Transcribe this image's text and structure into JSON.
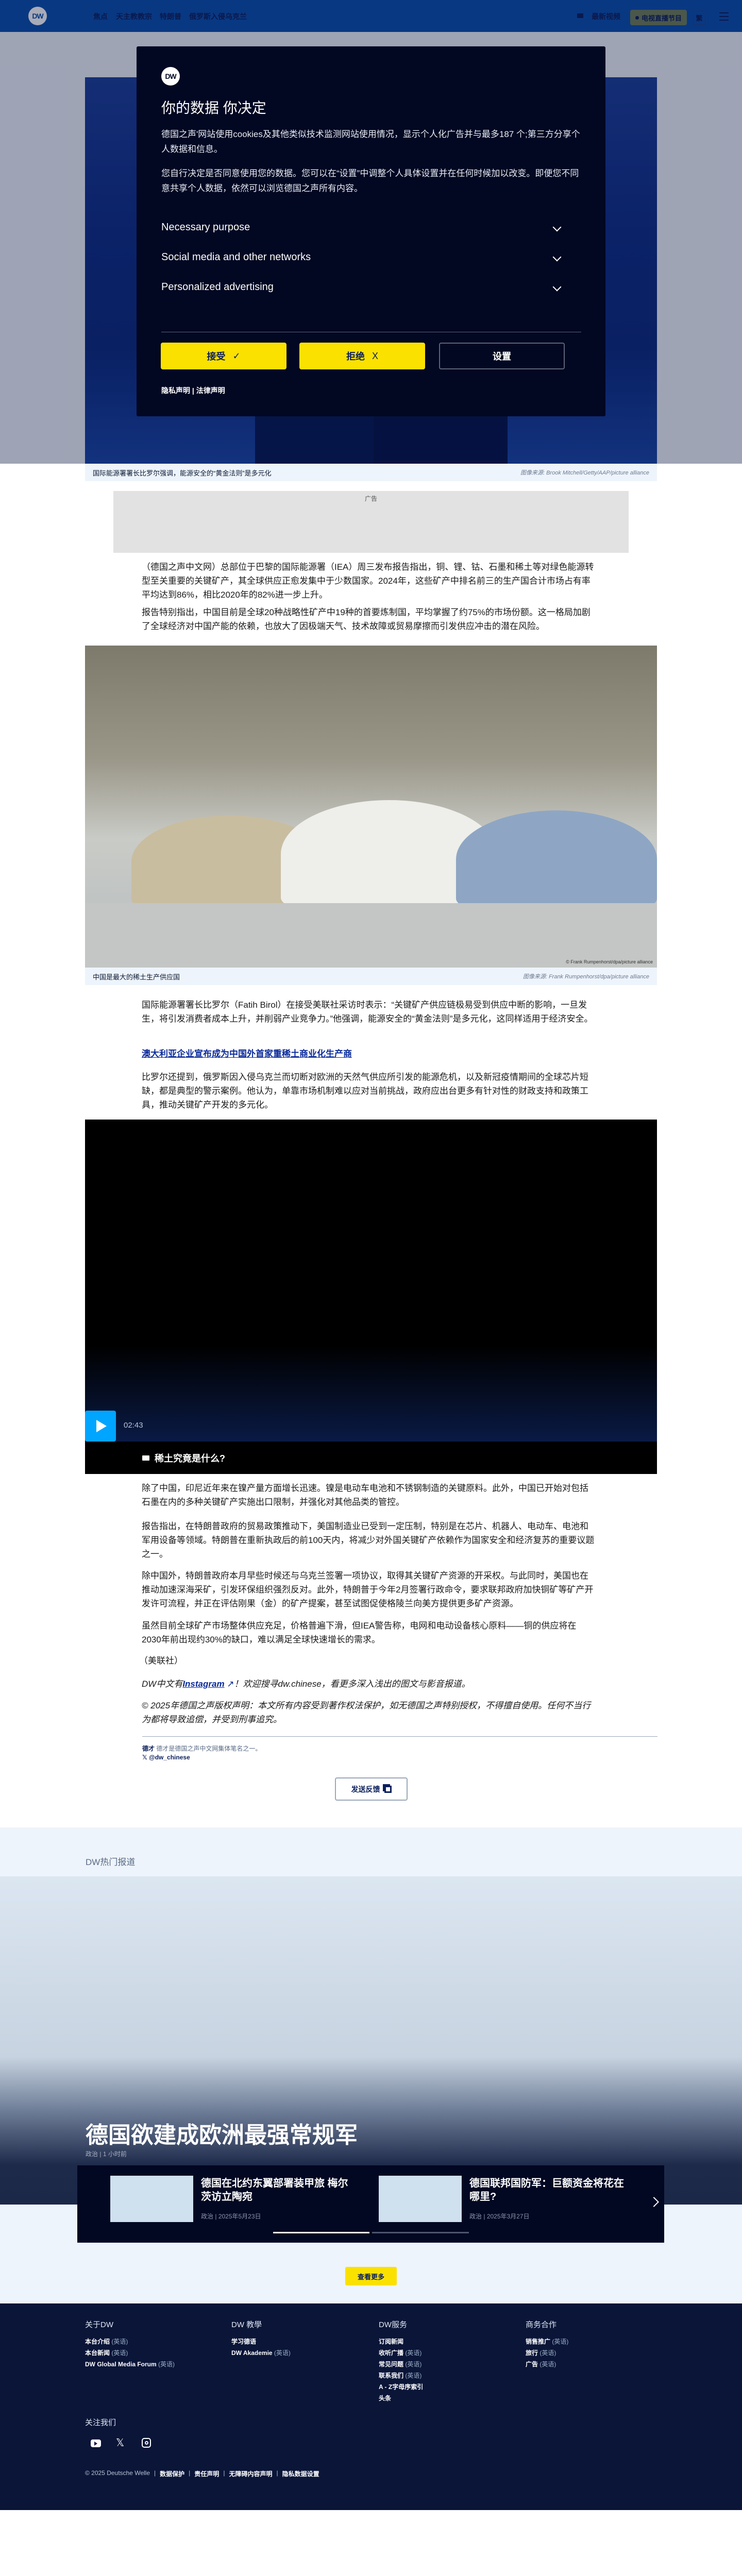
{
  "header": {
    "logo": "DW",
    "nav": [
      "焦点",
      "天主教教宗",
      "特朗普",
      "俄罗斯入侵乌克兰"
    ],
    "latest_videos": "最新视频",
    "live_tv": "电视直播节目",
    "lang_toggle": "繁"
  },
  "cookie_modal": {
    "logo": "DW",
    "title": "你的数据 你决定",
    "text1": "德国之声'网站使用cookies及其他类似技术监测网站使用情况，显示个人化广告并与最多187 个;第三方分享个人数据和信息。",
    "text2": "您自行决定是否同意使用您的数据。您可以在“设置”中调整个人具体设置并在任何时候加以改变。即便您不同意共享个人数据，依然可以浏览德国之声所有内容。",
    "sections": [
      "Necessary purpose",
      "Social media and other networks",
      "Personalized advertising"
    ],
    "accept": "接受",
    "reject": "拒绝",
    "settings": "设置",
    "privacy": "隐私声明",
    "legal": "法律声明"
  },
  "hero_caption": {
    "text": "国际能源署署长比罗尔强调，能源安全的“黄金法则”是多元化",
    "credit": "图像来源: Brook Mitchell/Getty/AAP/picture alliance"
  },
  "ad_label": "广告",
  "article": {
    "p1": "（德国之声中文网）总部位于巴黎的国际能源署（IEA）周三发布报告指出，铜、锂、钴、石墨和稀土等对绿色能源转型至关重要的关键矿产，其全球供应正愈发集中于少数国家。2024年，这些矿产中排名前三的生产国合计市场占有率平均达到86%，相比2020年的82%进一步上升。",
    "p2": "报告特别指出，中国目前是全球20种战略性矿产中19种的首要炼制国，平均掌握了约75%的市场份额。这一格局加剧了全球经济对中国产能的依赖，也放大了因极端天气、技术故障或贸易摩擦而引发供应冲击的潜在风险。",
    "image2_watermark": "© Frank Rumpenhorst/dpa/picture alliance",
    "image2_caption": "中国是最大的稀土生产供应国",
    "image2_credit": "图像来源: Frank Rumpenhorst/dpa/picture alliance",
    "p3": "国际能源署署长比罗尔（Fatih Birol）在接受美联社采访时表示：“关键矿产供应链极易受到供应中断的影响，一旦发生，将引发消费者成本上升，并削弱产业竞争力。”他强调，能源安全的“黄金法则”是多元化，这同样适用于经济安全。",
    "related_link": "澳大利亚企业宣布成为中国外首家重稀土商业化生产商",
    "p4": "比罗尔还提到，俄罗斯因入侵乌克兰而切断对欧洲的天然气供应所引发的能源危机，以及新冠疫情期间的全球芯片短缺，都是典型的警示案例。他认为，单靠市场机制难以应对当前挑战，政府应出台更多有针对性的财政支持和政策工具，推动关键矿产开发的多元化。",
    "video_duration": "02:43",
    "video_title": "稀土究竟是什么?",
    "p5": "除了中国，印尼近年来在镍产量方面增长迅速。镍是电动车电池和不锈钢制造的关键原料。此外，中国已开始对包括石墨在内的多种关键矿产实施出口限制，并强化对其他品类的管控。",
    "p6": "报告指出，在特朗普政府的贸易政策推动下，美国制造业已受到一定压制，特别是在芯片、机器人、电动车、电池和军用设备等领域。特朗普在重新执政后的前100天内，将减少对外国关键矿产依赖作为国家安全和经济复苏的重要议题之一。",
    "p7": "除中国外，特朗普政府本月早些时候还与乌克兰签署一项协议，取得其关键矿产资源的开采权。与此同时，美国也在推动加速深海采矿，引发环保组织强烈反对。此外，特朗普于今年2月签署行政命令，要求联邦政府加快铜矿等矿产开发许可流程，并正在评估刚果（金）的矿产提案，甚至试图促使格陵兰向美方提供更多矿产资源。",
    "p8": "虽然目前全球矿产市场整体供应充足，价格普遍下滑，但IEA警告称，电网和电动设备核心原料——铜的供应将在2030年前出现约30%的缺口，难以满足全球快速增长的需求。",
    "source": "（美联社）",
    "ig_prefix": "DW中文有",
    "ig_link": "Instagram",
    "ig_suffix": "！欢迎搜寻dw.chinese，看更多深入浅出的图文与影音报道。",
    "copyright": "© 2025年德国之声版权声明：本文所有内容受到著作权法保护，如无德国之声特别授权，不得擅自使用。任何不当行为都将导致追偿，并受到刑事追究。"
  },
  "author": {
    "name": "德才",
    "bio": "德才是德国之声中文网集体笔名之一。",
    "handle": "@dw_chinese"
  },
  "feedback_button": "发送反馈",
  "hot_topics": {
    "label": "DW热门报道",
    "title": "德国欲建成欧洲最强常规军",
    "category": "政治",
    "time": "1 小时前",
    "cards": [
      {
        "title": "德国在北约东翼部署装甲旅 梅尔茨访立陶宛",
        "category": "政治",
        "date": "2025年5月23日"
      },
      {
        "title": "德国联邦国防军：巨额资金将花在哪里?",
        "category": "政治",
        "date": "2025年3月27日"
      }
    ]
  },
  "more_button": "查看更多",
  "footer": {
    "columns": [
      {
        "heading": "关于DW",
        "links": [
          {
            "label": "本台介绍",
            "note": "(英语)"
          },
          {
            "label": "本台新闻",
            "note": "(英语)"
          },
          {
            "label": "DW Global Media Forum",
            "note": "(英语)"
          }
        ]
      },
      {
        "heading": "DW 教學",
        "links": [
          {
            "label": "学习德语",
            "note": ""
          },
          {
            "label": "DW Akademie",
            "note": "(英语)"
          }
        ]
      },
      {
        "heading": "DW服务",
        "links": [
          {
            "label": "订阅新闻",
            "note": ""
          },
          {
            "label": "收听广播",
            "note": "(英语)"
          },
          {
            "label": "常见问题",
            "note": "(英语)"
          },
          {
            "label": "联系我们",
            "note": "(英语)"
          },
          {
            "label": "A - Z字母序索引",
            "note": ""
          },
          {
            "label": "头条",
            "note": ""
          }
        ]
      },
      {
        "heading": "商务合作",
        "links": [
          {
            "label": "销售推广",
            "note": "(英语)"
          },
          {
            "label": "旅行",
            "note": "(英语)"
          },
          {
            "label": "广告",
            "note": "(英语)"
          }
        ]
      }
    ],
    "follow": "关注我们",
    "copyright": "© 2025 Deutsche Welle",
    "legal_links": [
      "数据保护",
      "责任声明",
      "无障碍内容声明",
      "隐私数据设置"
    ]
  },
  "colors": {
    "brand_blue": "#0a4fae",
    "navy": "#020722",
    "yellow": "#fae100",
    "play": "#00a5ff"
  }
}
